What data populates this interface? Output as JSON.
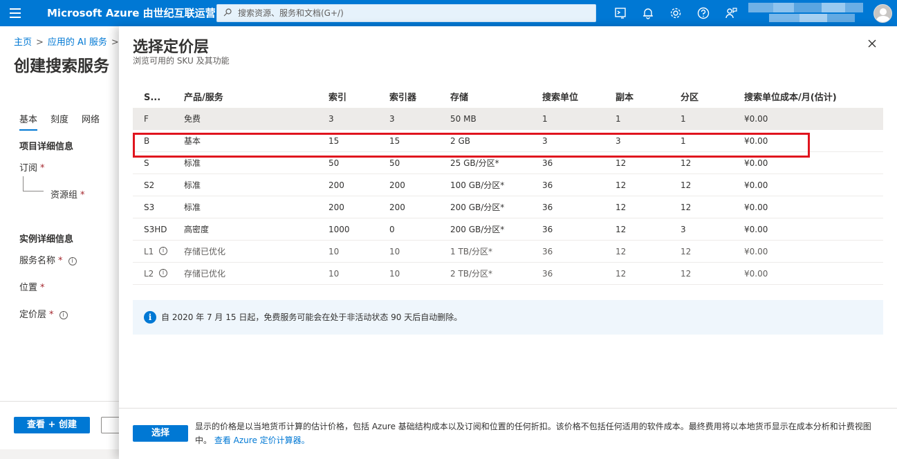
{
  "topbar": {
    "brand": "Microsoft Azure 由世纪互联运营",
    "search_placeholder": "搜索资源、服务和文档(G+/)",
    "icons": [
      "hamburger-icon",
      "search-icon",
      "cloud-shell-icon",
      "bell-icon",
      "gear-icon",
      "help-icon",
      "feedback-icon",
      "avatar-icon"
    ],
    "brand_color": "#0078d4"
  },
  "background_page": {
    "breadcrumb": [
      "主页",
      "应用的 AI 服务"
    ],
    "title": "创建搜索服务",
    "tabs": [
      "基本",
      "刻度",
      "网络"
    ],
    "project_section": "项目详细信息",
    "subscription_label": "订阅",
    "resource_group_label": "资源组",
    "instance_section": "实例详细信息",
    "service_name_label": "服务名称",
    "location_label": "位置",
    "pricing_tier_label": "定价层",
    "review_button": "查看 + 创建",
    "required_mark": "*"
  },
  "blade": {
    "title": "选择定价层",
    "subtitle": "浏览可用的 SKU 及其功能",
    "columns": [
      "S...",
      "产品/服务",
      "索引",
      "索引器",
      "存储",
      "搜索单位",
      "副本",
      "分区",
      "搜索单位成本/月(估计)"
    ],
    "rows": [
      {
        "sku": "F",
        "offer": "免费",
        "indexes": "3",
        "indexers": "3",
        "storage": "50 MB",
        "search_units": "1",
        "replicas": "1",
        "partitions": "1",
        "cost": "¥0.00",
        "selected": true,
        "dim": false
      },
      {
        "sku": "B",
        "offer": "基本",
        "indexes": "15",
        "indexers": "15",
        "storage": "2 GB",
        "search_units": "3",
        "replicas": "3",
        "partitions": "1",
        "cost": "¥0.00",
        "selected": false,
        "dim": false
      },
      {
        "sku": "S",
        "offer": "标准",
        "indexes": "50",
        "indexers": "50",
        "storage": "25 GB/分区*",
        "search_units": "36",
        "replicas": "12",
        "partitions": "12",
        "cost": "¥0.00",
        "selected": false,
        "dim": false
      },
      {
        "sku": "S2",
        "offer": "标准",
        "indexes": "200",
        "indexers": "200",
        "storage": "100 GB/分区*",
        "search_units": "36",
        "replicas": "12",
        "partitions": "12",
        "cost": "¥0.00",
        "selected": false,
        "dim": false
      },
      {
        "sku": "S3",
        "offer": "标准",
        "indexes": "200",
        "indexers": "200",
        "storage": "200 GB/分区*",
        "search_units": "36",
        "replicas": "12",
        "partitions": "12",
        "cost": "¥0.00",
        "selected": false,
        "dim": false
      },
      {
        "sku": "S3HD",
        "offer": "高密度",
        "indexes": "1000",
        "indexers": "0",
        "storage": "200 GB/分区*",
        "search_units": "36",
        "replicas": "12",
        "partitions": "3",
        "cost": "¥0.00",
        "selected": false,
        "dim": false
      },
      {
        "sku": "L1",
        "offer": "存储已优化",
        "indexes": "10",
        "indexers": "10",
        "storage": "1 TB/分区*",
        "search_units": "36",
        "replicas": "12",
        "partitions": "12",
        "cost": "¥0.00",
        "selected": false,
        "dim": true,
        "info": true
      },
      {
        "sku": "L2",
        "offer": "存储已优化",
        "indexes": "10",
        "indexers": "10",
        "storage": "2 TB/分区*",
        "search_units": "36",
        "replicas": "12",
        "partitions": "12",
        "cost": "¥0.00",
        "selected": false,
        "dim": true,
        "info": true
      }
    ],
    "info_banner": "自 2020 年 7 月 15 日起，免费服务可能会在处于非活动状态 90 天后自动删除。",
    "select_button": "选择",
    "footer_note": "显示的价格是以当地货币计算的估计价格，包括 Azure 基础结构成本以及订阅和位置的任何折扣。该价格不包括任何适用的软件成本。最终费用将以本地货币显示在成本分析和计费视图中。",
    "footer_link": "查看 Azure 定价计算器。",
    "highlight_color": "#e0141e"
  }
}
